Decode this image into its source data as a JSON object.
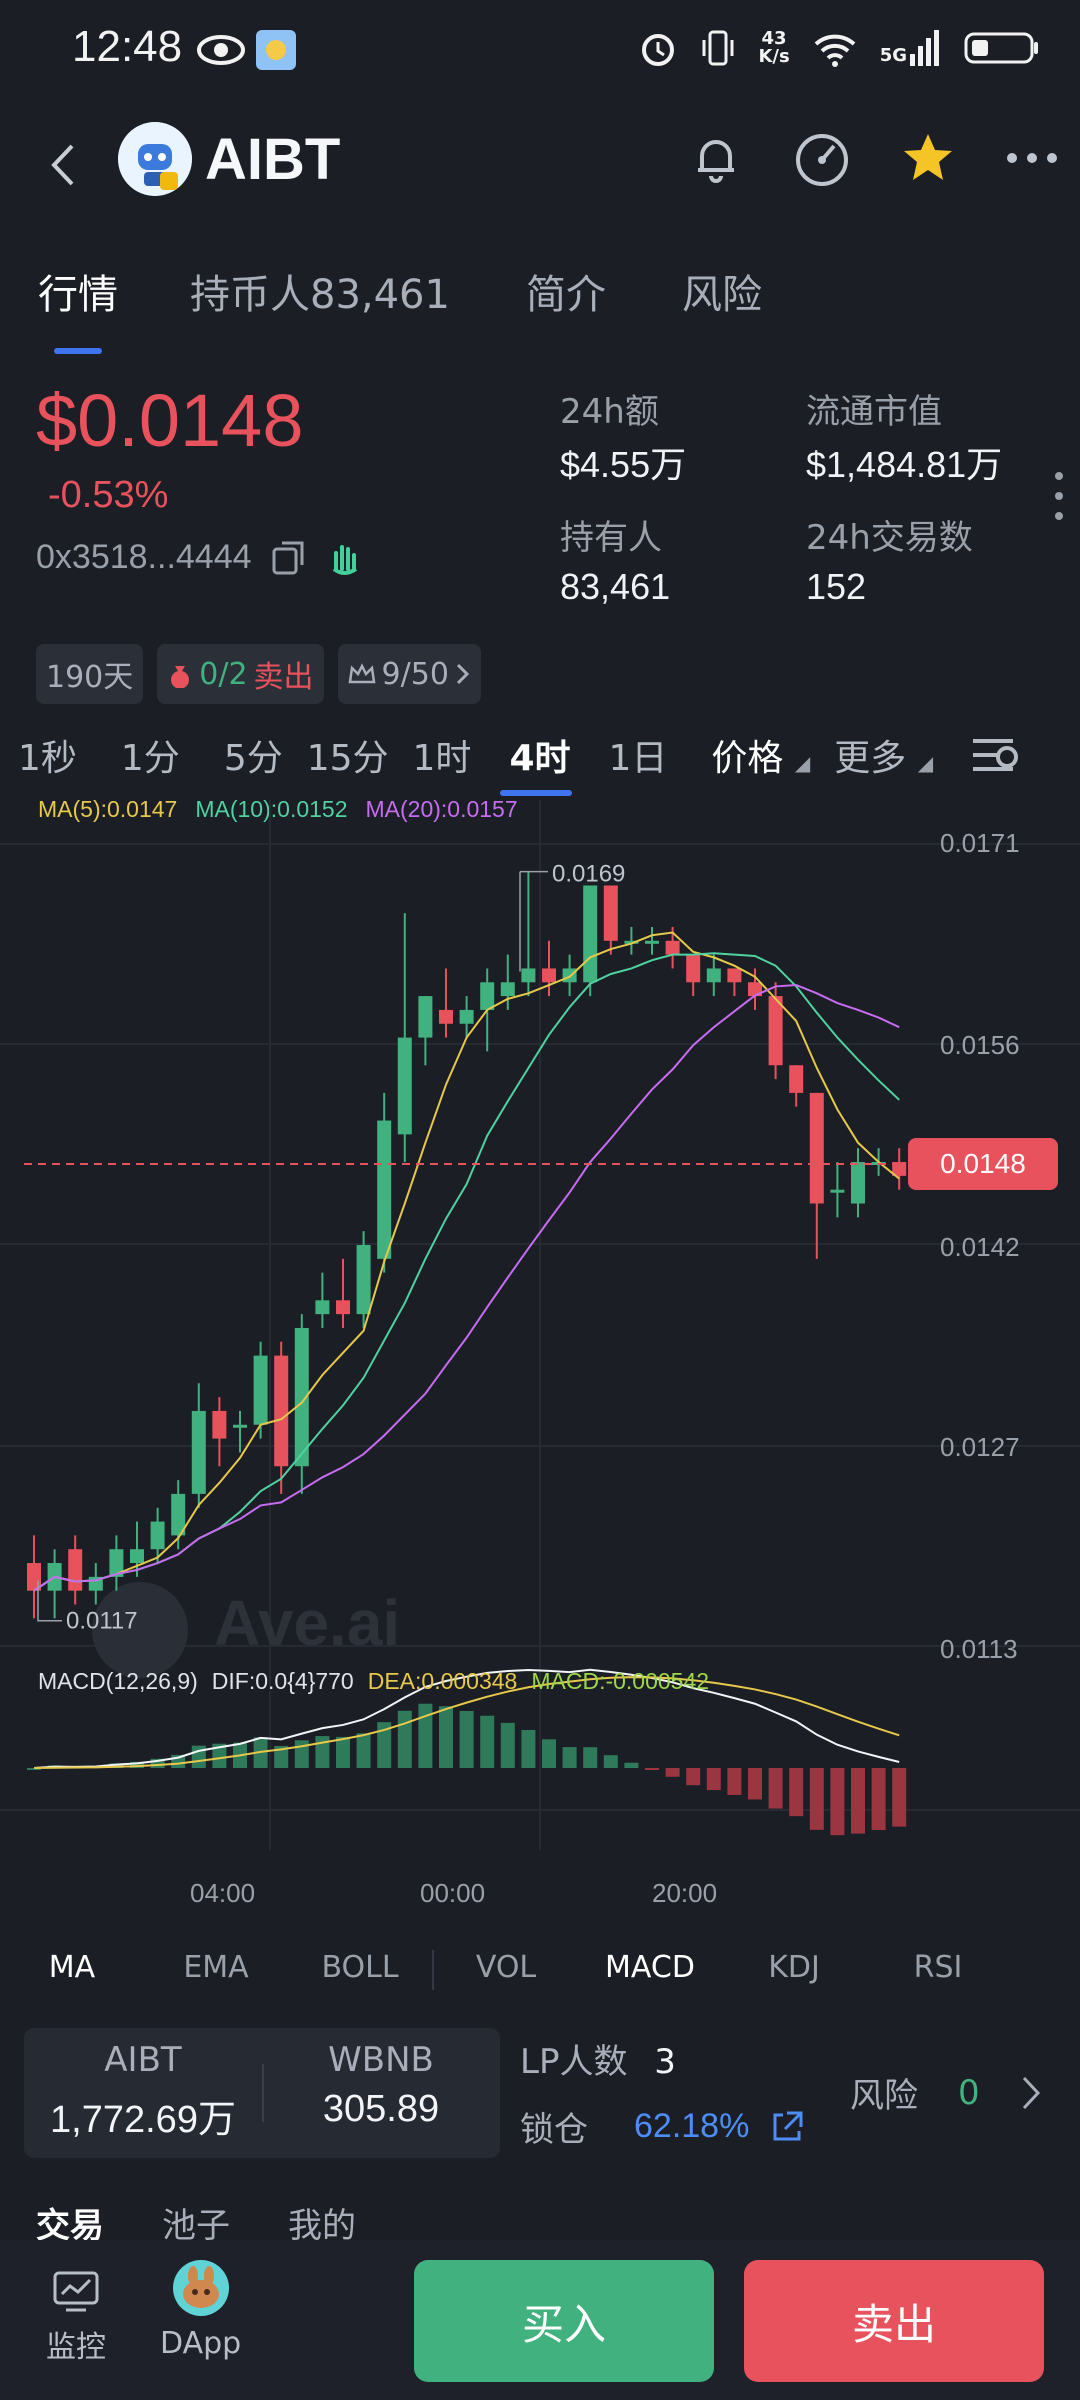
{
  "status_bar": {
    "time": "12:48",
    "net_speed_top": "43",
    "net_speed_bottom": "K/s",
    "signal_label": "5G"
  },
  "header": {
    "title": "AIBT"
  },
  "tabs": [
    {
      "label": "行情"
    },
    {
      "label": "持币人83,461"
    },
    {
      "label": "简介"
    },
    {
      "label": "风险"
    }
  ],
  "token": {
    "price": "$0.0148",
    "change": "-0.53%",
    "address": "0x3518...4444"
  },
  "stats": {
    "vol_label": "24h额",
    "vol_value": "$4.55万",
    "mcap_label": "流通市值",
    "mcap_value": "$1,484.81万",
    "holders_label": "持有人",
    "holders_value": "83,461",
    "tx_label": "24h交易数",
    "tx_value": "152"
  },
  "chips": {
    "age": "190天",
    "sell_count": "0/2",
    "sell_label": "卖出",
    "score": "9/50"
  },
  "timeframes": [
    {
      "label": "1秒"
    },
    {
      "label": "1分"
    },
    {
      "label": "5分"
    },
    {
      "label": "15分"
    },
    {
      "label": "1时"
    },
    {
      "label": "4时"
    },
    {
      "label": "1日"
    },
    {
      "label": "价格"
    },
    {
      "label": "更多"
    }
  ],
  "ma_legend": {
    "ma5": "MA(5):0.0147",
    "ma10": "MA(10):0.0152",
    "ma20": "MA(20):0.0157"
  },
  "macd_legend": {
    "name": "MACD(12,26,9)",
    "dif": "DIF:0.0{4}770",
    "dea": "DEA:0.000348",
    "macd": "MACD:-0.000542"
  },
  "chart_data": {
    "type": "candlestick",
    "y_ticks": [
      "0.0171",
      "0.0156",
      "0.0142",
      "0.0127",
      "0.0113"
    ],
    "current_price": "0.0148",
    "high_label": "0.0169",
    "low_label": "0.0117",
    "x_ticks": [
      "04:00",
      "00:00",
      "20:00"
    ],
    "watermark": "Ave.ai",
    "candles": [
      [
        0.0119,
        0.0121,
        0.0115,
        0.0117
      ],
      [
        0.0117,
        0.012,
        0.0115,
        0.0119
      ],
      [
        0.012,
        0.0121,
        0.0116,
        0.0117
      ],
      [
        0.0117,
        0.0119,
        0.0116,
        0.0118
      ],
      [
        0.0118,
        0.0121,
        0.0117,
        0.012
      ],
      [
        0.0119,
        0.0122,
        0.0118,
        0.012
      ],
      [
        0.012,
        0.0123,
        0.0119,
        0.0122
      ],
      [
        0.0121,
        0.0125,
        0.012,
        0.0124
      ],
      [
        0.0124,
        0.0132,
        0.0123,
        0.013
      ],
      [
        0.013,
        0.0131,
        0.0126,
        0.0128
      ],
      [
        0.0129,
        0.013,
        0.0127,
        0.0129
      ],
      [
        0.0129,
        0.0135,
        0.0128,
        0.0134
      ],
      [
        0.0134,
        0.0135,
        0.0124,
        0.0126
      ],
      [
        0.0126,
        0.0137,
        0.0124,
        0.0136
      ],
      [
        0.0137,
        0.014,
        0.0136,
        0.0138
      ],
      [
        0.0138,
        0.0141,
        0.0136,
        0.0137
      ],
      [
        0.0137,
        0.0143,
        0.0136,
        0.0142
      ],
      [
        0.0141,
        0.0153,
        0.014,
        0.0151
      ],
      [
        0.015,
        0.0166,
        0.0148,
        0.0157
      ],
      [
        0.0157,
        0.016,
        0.0155,
        0.016
      ],
      [
        0.0159,
        0.0162,
        0.0157,
        0.0158
      ],
      [
        0.0158,
        0.016,
        0.0157,
        0.0159
      ],
      [
        0.0159,
        0.0162,
        0.0156,
        0.0161
      ],
      [
        0.016,
        0.0163,
        0.0159,
        0.0161
      ],
      [
        0.0161,
        0.0169,
        0.016,
        0.0162
      ],
      [
        0.0162,
        0.0164,
        0.016,
        0.0161
      ],
      [
        0.0161,
        0.0163,
        0.016,
        0.0162
      ],
      [
        0.0161,
        0.0168,
        0.016,
        0.0168
      ],
      [
        0.0168,
        0.0168,
        0.0163,
        0.0164
      ],
      [
        0.0164,
        0.0165,
        0.0163,
        0.0164
      ],
      [
        0.0164,
        0.0165,
        0.0163,
        0.0164
      ],
      [
        0.0164,
        0.0165,
        0.0162,
        0.0163
      ],
      [
        0.0163,
        0.0163,
        0.016,
        0.0161
      ],
      [
        0.0161,
        0.0163,
        0.016,
        0.0162
      ],
      [
        0.0162,
        0.0162,
        0.016,
        0.0161
      ],
      [
        0.0161,
        0.0162,
        0.0159,
        0.016
      ],
      [
        0.016,
        0.0161,
        0.0154,
        0.0155
      ],
      [
        0.0155,
        0.0155,
        0.0152,
        0.0153
      ],
      [
        0.0153,
        0.0153,
        0.0141,
        0.0145
      ],
      [
        0.0146,
        0.0148,
        0.0144,
        0.0146
      ],
      [
        0.0145,
        0.0149,
        0.0144,
        0.0148
      ],
      [
        0.0148,
        0.0149,
        0.0147,
        0.0148
      ],
      [
        0.0148,
        0.0149,
        0.0146,
        0.0147
      ]
    ]
  },
  "indicators": [
    {
      "label": "MA"
    },
    {
      "label": "EMA"
    },
    {
      "label": "BOLL"
    },
    {
      "label": "VOL"
    },
    {
      "label": "MACD"
    },
    {
      "label": "KDJ"
    },
    {
      "label": "RSI"
    }
  ],
  "pair": {
    "base": "AIBT",
    "base_amount": "1,772.69万",
    "quote": "WBNB",
    "quote_amount": "305.89"
  },
  "lp": {
    "label": "LP人数",
    "value": "3"
  },
  "lock": {
    "label": "锁仓",
    "value": "62.18%"
  },
  "risk": {
    "label": "风险",
    "value": "0"
  },
  "bottom_tabs": [
    {
      "label": "交易"
    },
    {
      "label": "池子"
    },
    {
      "label": "我的"
    }
  ],
  "bottom_nav": {
    "monitor": "监控",
    "dapp": "DApp",
    "buy": "买入",
    "sell": "卖出"
  },
  "colors": {
    "up": "#41b27f",
    "down": "#e8525d",
    "ma5": "#e6c84b",
    "ma10": "#4fd1a0",
    "ma20": "#c66cf0",
    "accent": "#3f73f0"
  }
}
